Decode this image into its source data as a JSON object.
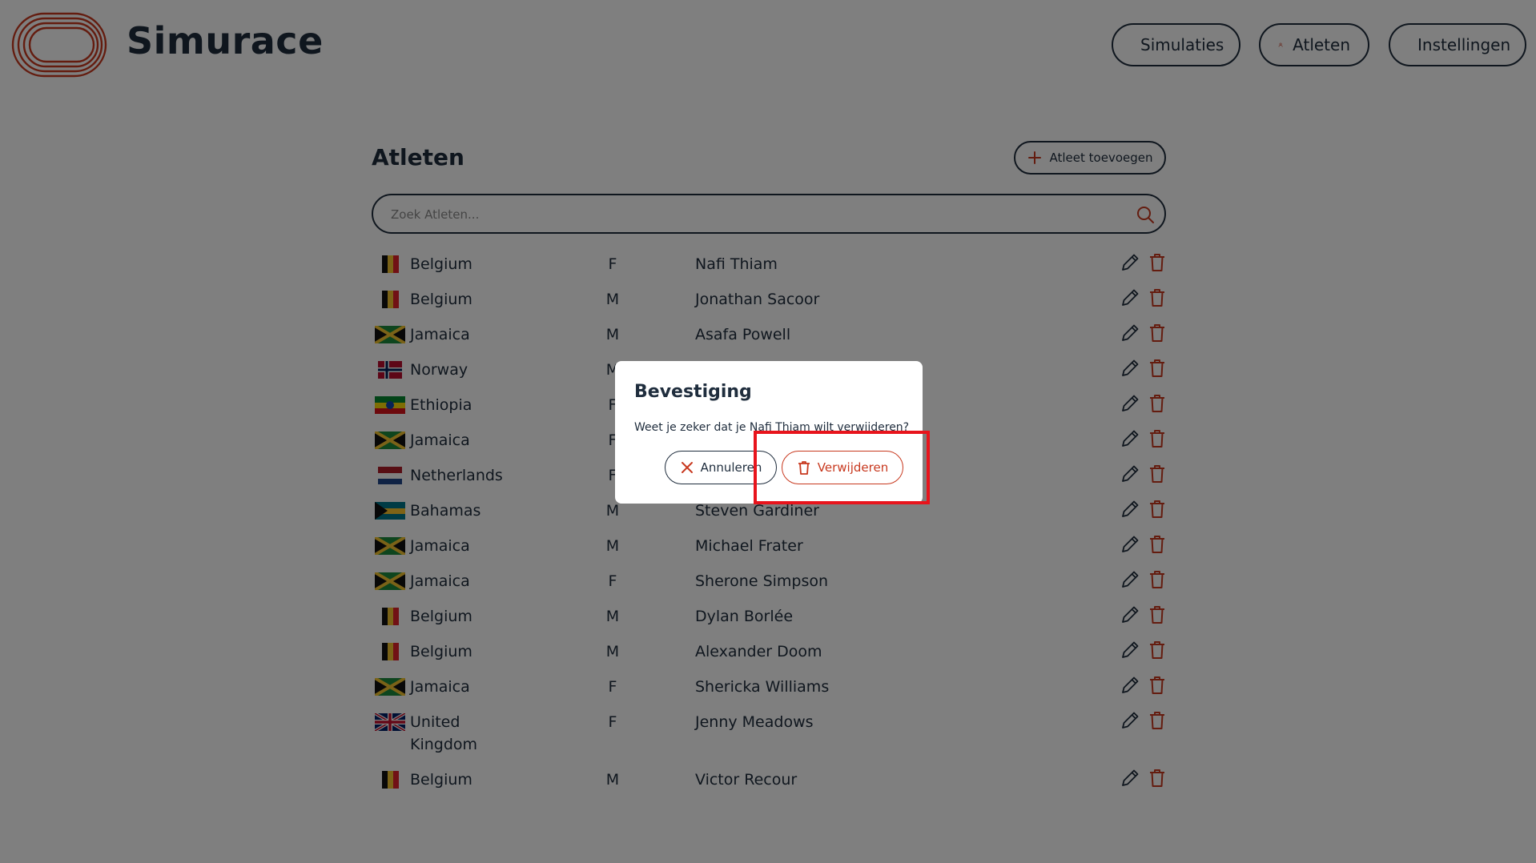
{
  "app": {
    "title": "Simurace",
    "nav": [
      {
        "label": "Simulaties",
        "icon": "play-icon"
      },
      {
        "label": "Atleten",
        "icon": "user-icon"
      },
      {
        "label": "Instellingen",
        "icon": "gear-icon"
      }
    ]
  },
  "colors": {
    "accent": "#c8391f",
    "text": "#1f2d3d",
    "highlight": "#e8141c"
  },
  "page": {
    "title": "Atleten",
    "add_label": "Atleet toevoegen",
    "search_placeholder": "Zoek Atleten..."
  },
  "athletes": [
    {
      "country": "Belgium",
      "flag": "be",
      "gender": "F",
      "name": "Nafi Thiam"
    },
    {
      "country": "Belgium",
      "flag": "be",
      "gender": "M",
      "name": "Jonathan Sacoor"
    },
    {
      "country": "Jamaica",
      "flag": "jm",
      "gender": "M",
      "name": "Asafa Powell"
    },
    {
      "country": "Norway",
      "flag": "no",
      "gender": "M",
      "name": ""
    },
    {
      "country": "Ethiopia",
      "flag": "et",
      "gender": "F",
      "name": ""
    },
    {
      "country": "Jamaica",
      "flag": "jm",
      "gender": "F",
      "name": ""
    },
    {
      "country": "Netherlands",
      "flag": "nl",
      "gender": "F",
      "name": ""
    },
    {
      "country": "Bahamas",
      "flag": "bs",
      "gender": "M",
      "name": "Steven Gardiner"
    },
    {
      "country": "Jamaica",
      "flag": "jm",
      "gender": "M",
      "name": "Michael Frater"
    },
    {
      "country": "Jamaica",
      "flag": "jm",
      "gender": "F",
      "name": "Sherone Simpson"
    },
    {
      "country": "Belgium",
      "flag": "be",
      "gender": "M",
      "name": "Dylan Borlée"
    },
    {
      "country": "Belgium",
      "flag": "be",
      "gender": "M",
      "name": "Alexander Doom"
    },
    {
      "country": "Jamaica",
      "flag": "jm",
      "gender": "F",
      "name": "Shericka Williams"
    },
    {
      "country": "United Kingdom",
      "flag": "gb",
      "gender": "F",
      "name": "Jenny Meadows"
    },
    {
      "country": "Belgium",
      "flag": "be",
      "gender": "M",
      "name": "Victor Recour"
    }
  ],
  "modal": {
    "title": "Bevestiging",
    "message": "Weet je zeker dat je Nafi Thiam wilt verwijderen?",
    "cancel_label": "Annuleren",
    "confirm_label": "Verwijderen"
  }
}
